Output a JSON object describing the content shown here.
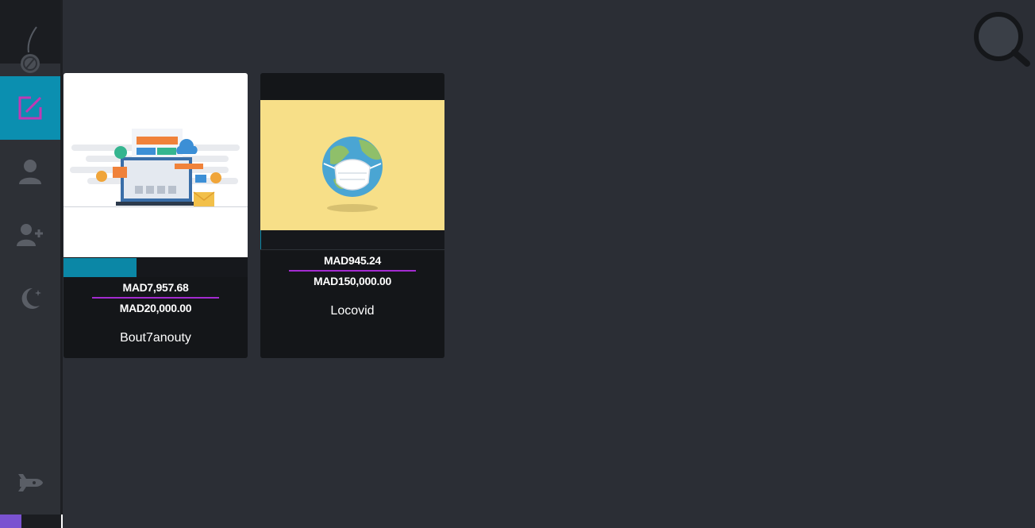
{
  "sidebar": {
    "items": [
      {
        "icon": "edit-icon",
        "active": true
      },
      {
        "icon": "user-icon",
        "active": false
      },
      {
        "icon": "add-user-icon",
        "active": false
      },
      {
        "icon": "dark-mode-icon",
        "active": false
      },
      {
        "icon": "rocket-icon",
        "active": false
      }
    ]
  },
  "search": {
    "icon": "search-icon"
  },
  "campaigns": [
    {
      "title": "Bout7anouty",
      "raised": "MAD7,957.68",
      "goal": "MAD20,000.00",
      "progress": 0.398,
      "image": "web-development-illustration"
    },
    {
      "title": "Locovid",
      "raised": "MAD945.24",
      "goal": "MAD150,000.00",
      "progress": 0.006,
      "image": "globe-with-mask-illustration"
    }
  ],
  "colors": {
    "accent": "#0b8fb0",
    "divider": "#a32bd0",
    "background": "#2b2e35",
    "card": "#141619"
  }
}
